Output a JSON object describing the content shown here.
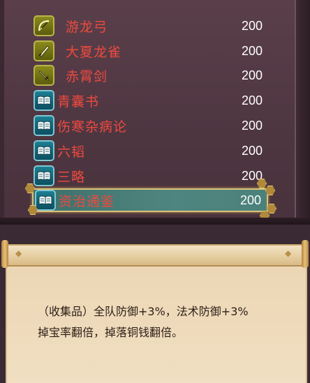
{
  "items": [
    {
      "name": "游龙弓",
      "price": "200",
      "type": "weapon",
      "icon": "bow-icon",
      "selected": false
    },
    {
      "name": "大夏龙雀",
      "price": "200",
      "type": "weapon",
      "icon": "blade-icon",
      "selected": false
    },
    {
      "name": "赤霄剑",
      "price": "200",
      "type": "weapon",
      "icon": "sword-icon",
      "selected": false
    },
    {
      "name": "青囊书",
      "price": "200",
      "type": "book",
      "icon": "book-icon",
      "selected": false
    },
    {
      "name": "伤寒杂病论",
      "price": "200",
      "type": "book",
      "icon": "book-icon",
      "selected": false
    },
    {
      "name": "六韬",
      "price": "200",
      "type": "book",
      "icon": "book-icon",
      "selected": false
    },
    {
      "name": "三略",
      "price": "200",
      "type": "book",
      "icon": "book-icon",
      "selected": false
    },
    {
      "name": "资治通鉴",
      "price": "200",
      "type": "book",
      "icon": "book-icon",
      "selected": true
    }
  ],
  "description": {
    "line1": "（收集品）全队防御+3%，法术防御+3%",
    "line2": "掉宝率翻倍，掉落铜钱翻倍。"
  },
  "colors": {
    "item_name": "#ee4a3f",
    "price": "#ffffff",
    "selected_bg": "#4f8580",
    "selected_border": "#d9c27a"
  }
}
